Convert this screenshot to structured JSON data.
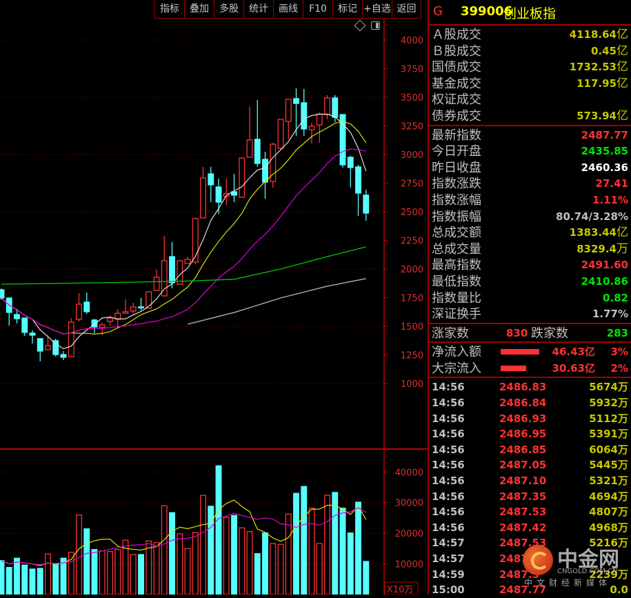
{
  "toolbar": {
    "buttons": [
      "指标",
      "叠加",
      "多股",
      "统计",
      "画线",
      "F10",
      "标记",
      "+自选",
      "返回"
    ]
  },
  "chart_icons": [
    "diamond-icon",
    "panel-toggle-icon"
  ],
  "colors": {
    "up": "#ff3232",
    "down": "#54ffff",
    "ma5": "#e0e0e0",
    "ma10": "#e0e000",
    "ma20": "#e000e0",
    "ma_green": "#00c000",
    "ma_gray": "#b0b0b0",
    "grid": "#900000",
    "axis": "#c00000"
  },
  "chart_data": [
    {
      "type": "candlestick",
      "y_ticks": [
        4000,
        3750,
        3500,
        3250,
        3000,
        2750,
        2500,
        2250,
        2000,
        1750,
        1500,
        1250,
        1000
      ],
      "ylim": [
        1000,
        4000
      ],
      "grid_lines": [
        4000,
        3500,
        3000,
        2500,
        2000,
        1500,
        1000
      ],
      "ohlc": [
        [
          1819,
          1830,
          1730,
          1747
        ],
        [
          1747,
          1750,
          1506,
          1621
        ],
        [
          1602,
          1651,
          1524,
          1566
        ],
        [
          1572,
          1572,
          1416,
          1446
        ],
        [
          1440,
          1464,
          1349,
          1422
        ],
        [
          1392,
          1392,
          1193,
          1283
        ],
        [
          1295,
          1404,
          1295,
          1331
        ],
        [
          1374,
          1392,
          1235,
          1253
        ],
        [
          1253,
          1283,
          1205,
          1229
        ],
        [
          1235,
          1572,
          1235,
          1536
        ],
        [
          1560,
          1789,
          1542,
          1693
        ],
        [
          1711,
          1795,
          1608,
          1627
        ],
        [
          1554,
          1566,
          1440,
          1494
        ],
        [
          1488,
          1530,
          1422,
          1512
        ],
        [
          1542,
          1590,
          1506,
          1572
        ],
        [
          1560,
          1651,
          1488,
          1614
        ],
        [
          1614,
          1735,
          1614,
          1627
        ],
        [
          1633,
          1705,
          1608,
          1669
        ],
        [
          1669,
          1747,
          1639,
          1663
        ],
        [
          1657,
          1801,
          1657,
          1801
        ],
        [
          1813,
          1994,
          1813,
          1928
        ],
        [
          1765,
          2289,
          1765,
          2072
        ],
        [
          2108,
          2235,
          1831,
          1880
        ],
        [
          1867,
          2072,
          1867,
          2072
        ],
        [
          2048,
          2108,
          2048,
          2084
        ],
        [
          2060,
          2450,
          2040,
          2440
        ],
        [
          2446,
          2892,
          2446,
          2795
        ],
        [
          2831,
          2892,
          2584,
          2735
        ],
        [
          2717,
          2789,
          2482,
          2584
        ],
        [
          2633,
          2789,
          2560,
          2657
        ],
        [
          2675,
          2831,
          2584,
          2645
        ],
        [
          2627,
          2970,
          2627,
          2970
        ],
        [
          2976,
          3422,
          2976,
          3127
        ],
        [
          3133,
          3476,
          2892,
          2922
        ],
        [
          2958,
          3024,
          2614,
          2759
        ],
        [
          2765,
          3102,
          2711,
          3090
        ],
        [
          3054,
          3307,
          3054,
          3307
        ],
        [
          3289,
          3482,
          3133,
          3482
        ],
        [
          3488,
          3578,
          3163,
          3446
        ],
        [
          3452,
          3572,
          3163,
          3223
        ],
        [
          3217,
          3277,
          3096,
          3247
        ],
        [
          3259,
          3367,
          3102,
          3355
        ],
        [
          3349,
          3518,
          3307,
          3494
        ],
        [
          3494,
          3518,
          3283,
          3325
        ],
        [
          3349,
          3349,
          2886,
          2910
        ],
        [
          2976,
          2988,
          2711,
          2886
        ],
        [
          2892,
          2910,
          2464,
          2663
        ],
        [
          2645,
          2693,
          2422,
          2488
        ]
      ],
      "ma_periods": [
        5,
        10,
        20
      ],
      "ma_long_green": [
        [
          0,
          1867
        ],
        [
          13,
          1880
        ],
        [
          24,
          1895
        ],
        [
          30,
          1910
        ],
        [
          36,
          2000
        ],
        [
          42,
          2108
        ],
        [
          47,
          2193
        ]
      ],
      "ma_long_gray": [
        [
          24,
          1518
        ],
        [
          30,
          1620
        ],
        [
          36,
          1747
        ],
        [
          42,
          1850
        ],
        [
          47,
          1916
        ]
      ]
    },
    {
      "type": "bar",
      "y_ticks": [
        40000,
        30000,
        20000,
        10000
      ],
      "unit_label": "X10万",
      "values": [
        11030,
        8780,
        11800,
        9540,
        8260,
        8480,
        13160,
        9770,
        11800,
        13760,
        25920,
        21410,
        14640,
        14190,
        13990,
        14640,
        17660,
        13000,
        13000,
        17440,
        16920,
        28940,
        26690,
        19760,
        14960,
        20210,
        32330,
        28790,
        42030,
        25180,
        25790,
        21730,
        20510,
        13290,
        20060,
        16600,
        16310,
        26240,
        33010,
        35260,
        28180,
        16600,
        32400,
        33300,
        28180,
        20060,
        30140,
        10740
      ],
      "ma_periods": [
        5,
        10
      ]
    }
  ],
  "panel": {
    "prefix": "G",
    "code": "399006",
    "name": "创业板指",
    "turnover": [
      {
        "label": "Ａ股成交",
        "value": "4118.64",
        "unit": "亿"
      },
      {
        "label": "Ｂ股成交",
        "value": "0.45",
        "unit": "亿"
      },
      {
        "label": "国债成交",
        "value": "1732.53",
        "unit": "亿"
      },
      {
        "label": "基金成交",
        "value": "117.95",
        "unit": "亿"
      },
      {
        "label": "权证成交",
        "value": "",
        "unit": ""
      },
      {
        "label": "债券成交",
        "value": "573.94",
        "unit": "亿"
      }
    ],
    "stats": [
      {
        "label": "最新指数",
        "value": "2487.77",
        "color": "rd"
      },
      {
        "label": "今日开盘",
        "value": "2435.85",
        "color": "gr"
      },
      {
        "label": "昨日收盘",
        "value": "2460.36",
        "color": "wh"
      },
      {
        "label": "指数涨跌",
        "value": "27.41",
        "color": "rd"
      },
      {
        "label": "指数涨幅",
        "value": "1.11%",
        "color": "rd"
      },
      {
        "label": "指数振幅",
        "value": "80.74/3.28%",
        "color": "gy"
      },
      {
        "label": "总成交额",
        "value": "1383.44",
        "unit": "亿",
        "color": "yl"
      },
      {
        "label": "总成交量",
        "value": "8329.4",
        "unit": "万",
        "color": "yl"
      },
      {
        "label": "最高指数",
        "value": "2491.60",
        "color": "rd"
      },
      {
        "label": "最低指数",
        "value": "2410.86",
        "color": "gr"
      },
      {
        "label": "指数量比",
        "value": "0.82",
        "color": "gr"
      },
      {
        "label": "深证换手",
        "value": "1.77%",
        "color": "gy"
      }
    ],
    "breadth": {
      "up_label": "涨家数",
      "up_value": "830",
      "down_label": "跌家数",
      "down_value": "283"
    },
    "flows": [
      {
        "label": "净流入额",
        "value": "46.43亿",
        "pct": "3%",
        "bar": 3
      },
      {
        "label": "大宗流入",
        "value": "30.63亿",
        "pct": "2%",
        "bar": 2
      }
    ],
    "ticks": [
      {
        "time": "14:56",
        "price": "2486.83",
        "vol": "5674万"
      },
      {
        "time": "14:56",
        "price": "2486.84",
        "vol": "5932万"
      },
      {
        "time": "14:56",
        "price": "2486.93",
        "vol": "5112万"
      },
      {
        "time": "14:56",
        "price": "2486.95",
        "vol": "5391万"
      },
      {
        "time": "14:56",
        "price": "2486.85",
        "vol": "6064万"
      },
      {
        "time": "14:56",
        "price": "2487.05",
        "vol": "5445万"
      },
      {
        "time": "14:56",
        "price": "2487.10",
        "vol": "5321万"
      },
      {
        "time": "14:56",
        "price": "2487.35",
        "vol": "4694万"
      },
      {
        "time": "14:56",
        "price": "2487.53",
        "vol": "4807万"
      },
      {
        "time": "14:56",
        "price": "2487.42",
        "vol": "4968万"
      },
      {
        "time": "14:57",
        "price": "2487.53",
        "vol": "5216万"
      },
      {
        "time": "14:57",
        "price": "2487",
        "vol": ""
      },
      {
        "time": "14:59",
        "price": "2487.5",
        "vol": "2239万"
      },
      {
        "time": "15:00",
        "price": "2487.77",
        "vol": "0.0"
      }
    ]
  },
  "watermark": {
    "name": "中金网",
    "domain": "CNGOLD.COM.CN",
    "slogan": "中文财经新媒体"
  }
}
